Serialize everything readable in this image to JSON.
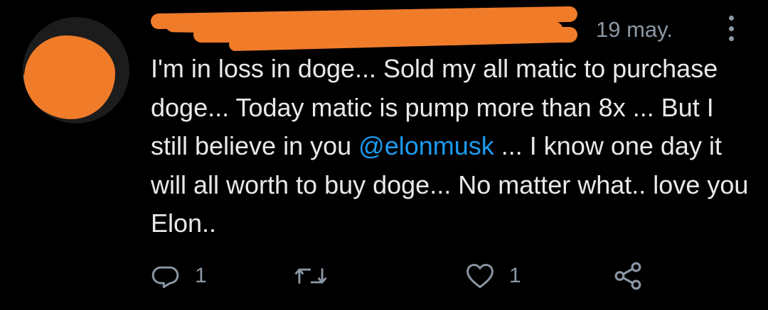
{
  "tweet": {
    "date": "19 may.",
    "text": {
      "part1": "I'm in loss in doge... Sold my all matic to purchase doge... Today matic is pump more than 8x ... But I still believe in you ",
      "mention": "@elonmusk",
      "part2": " ... I know one day it will all worth to buy doge... No matter what.. love you Elon.."
    },
    "actions": {
      "reply_count": "1",
      "retweet_count": "",
      "like_count": "1"
    }
  },
  "colors": {
    "background": "#000000",
    "text": "#e7e9ea",
    "secondary": "#8b98a5",
    "mention": "#1d9bf0",
    "redaction": "#f07c2a"
  },
  "icons": {
    "reply": "reply-icon",
    "retweet": "retweet-icon",
    "like": "heart-icon",
    "share": "share-icon",
    "more": "more-options-icon"
  }
}
